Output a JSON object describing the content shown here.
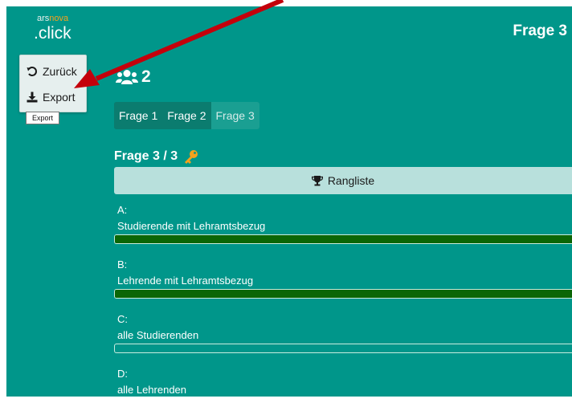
{
  "brand": {
    "prefix": "ars",
    "highlight": "nova",
    "suffix": ".click"
  },
  "header": {
    "title": "Frage 3"
  },
  "side_menu": {
    "back_label": "Zurück",
    "export_label": "Export",
    "tooltip": "Export"
  },
  "participants": {
    "count": "2"
  },
  "tabs": [
    {
      "label": "Frage 1"
    },
    {
      "label": "Frage 2"
    },
    {
      "label": "Frage 3"
    }
  ],
  "question": {
    "label": "Frage 3 / 3"
  },
  "rangliste": {
    "label": "Rangliste"
  },
  "answers": [
    {
      "letter": "A:",
      "text": "Studierende mit Lehramtsbezug",
      "fill": 1.0
    },
    {
      "letter": "B:",
      "text": "Lehrende mit Lehramtsbezug",
      "fill": 1.0
    },
    {
      "letter": "C:",
      "text": "alle Studierenden",
      "fill": 0.0
    },
    {
      "letter": "D:",
      "text": "alle Lehrenden",
      "fill": 0.0
    }
  ],
  "colors": {
    "background": "#00968a",
    "bar_fill": "#0b6606",
    "accent_orange": "#f4a21c",
    "annotation_arrow": "#c4000b"
  },
  "icons": {
    "back": "undo-icon",
    "export": "download-icon",
    "participants": "users-icon",
    "key": "key-icon",
    "trophy": "trophy-icon"
  }
}
